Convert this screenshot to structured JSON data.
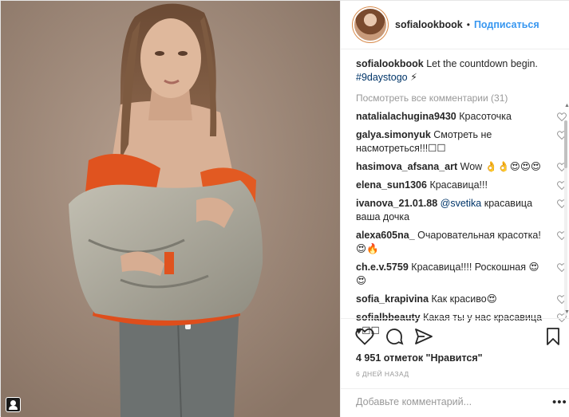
{
  "post": {
    "username": "sofialookbook",
    "follow_label": "Подписаться",
    "separator": "•"
  },
  "caption": {
    "username": "sofialookbook",
    "text": "Let the countdown begin.",
    "hashtag": "#9daystogo",
    "emoji": "⚡"
  },
  "view_all_comments": "Посмотреть все комментарии (31)",
  "comments": [
    {
      "user": "natalialachugina9430",
      "text": "Красоточка"
    },
    {
      "user": "galya.simonyuk",
      "text": "Смотреть не насмотреться!!!☐☐"
    },
    {
      "user": "hasimova_afsana_art",
      "text": "Wow 👌👌😍😍😍"
    },
    {
      "user": "elena_sun1306",
      "text": "Красавица!!!"
    },
    {
      "user": "ivanova_21.01.88",
      "mention": "@svetika",
      "text": "красавица ваша дочка"
    },
    {
      "user": "alexa605na_",
      "text": "Очаровательная красотка! 😍🔥"
    },
    {
      "user": "ch.e.v.5759",
      "text": "Красавица!!!! Роскошная 😍😍"
    },
    {
      "user": "sofia_krapivina",
      "text": "Как красиво😍"
    },
    {
      "user": "sofialbbeauty",
      "text": "Какая ты у нас красавица ♥☐☐"
    }
  ],
  "likes": "4 951 отметок \"Нравится\"",
  "timestamp": "6 ДНЕЙ НАЗАД",
  "comment_placeholder": "Добавьте комментарий...",
  "more_label": "•••",
  "icons": [
    "heart-icon",
    "comment-icon",
    "share-icon",
    "bookmark-icon",
    "user-tag-icon"
  ],
  "colors": {
    "link": "#3897f0",
    "hashtag": "#003569",
    "muted": "#999999",
    "text": "#262626"
  }
}
